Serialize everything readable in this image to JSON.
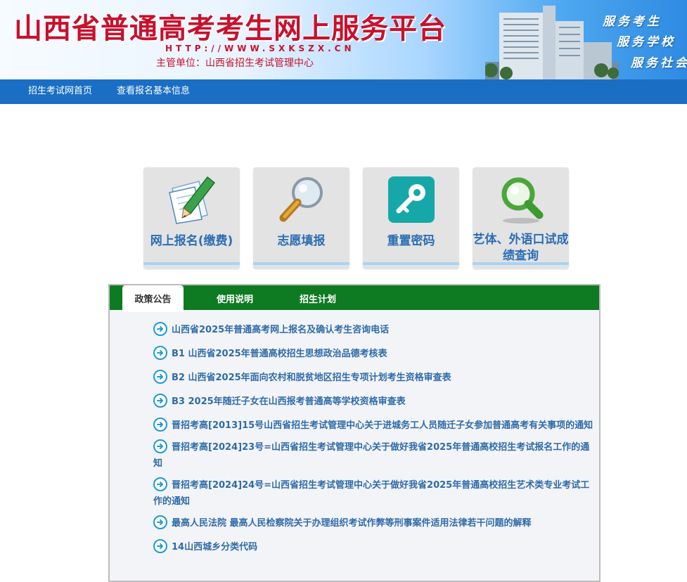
{
  "header": {
    "title": "山西省普通高考考生网上服务平台",
    "url": "HTTP://WWW.SXKSZX.CN",
    "org": "主管单位：山西省招生考试管理中心",
    "slogans": [
      "服务考生",
      "服务学校",
      "服务社会"
    ]
  },
  "nav": {
    "items": [
      "招生考试网首页",
      "查看报名基本信息"
    ]
  },
  "tiles": [
    {
      "label": "网上报名(缴费)",
      "icon": "pencil-paper-icon"
    },
    {
      "label": "志愿填报",
      "icon": "magnifier-icon"
    },
    {
      "label": "重置密码",
      "icon": "key-icon"
    },
    {
      "label": "艺体、外语口试成绩查询",
      "icon": "search-icon"
    }
  ],
  "tabs": [
    {
      "label": "政策公告",
      "active": true
    },
    {
      "label": "使用说明",
      "active": false
    },
    {
      "label": "招生计划",
      "active": false
    }
  ],
  "notices": [
    "山西省2025年普通高考网上报名及确认考生咨询电话",
    "B1 山西省2025年普通高校招生思想政治品德考核表",
    "B2 山西省2025年面向农村和脱贫地区招生专项计划考生资格审查表",
    "B3 2025年随迁子女在山西报考普通高等学校资格审查表",
    "晋招考高[2013]15号山西省招生考试管理中心关于进城务工人员随迁子女参加普通高考有关事项的通知",
    "晋招考高[2024]23号=山西省招生考试管理中心关于做好我省2025年普通高校招生考试报名工作的通知",
    "晋招考高[2024]24号=山西省招生考试管理中心关于做好我省2025年普通高校招生艺术类专业考试工作的通知",
    "最高人民法院 最高人民检察院关于办理组织考试作弊等刑事案件适用法律若干问题的解释",
    "14山西城乡分类代码"
  ],
  "colors": {
    "brand_red": "#c8112d",
    "nav_blue": "#1a6fc4",
    "tab_green": "#0e7a21",
    "link_blue": "#2f6ba8"
  }
}
